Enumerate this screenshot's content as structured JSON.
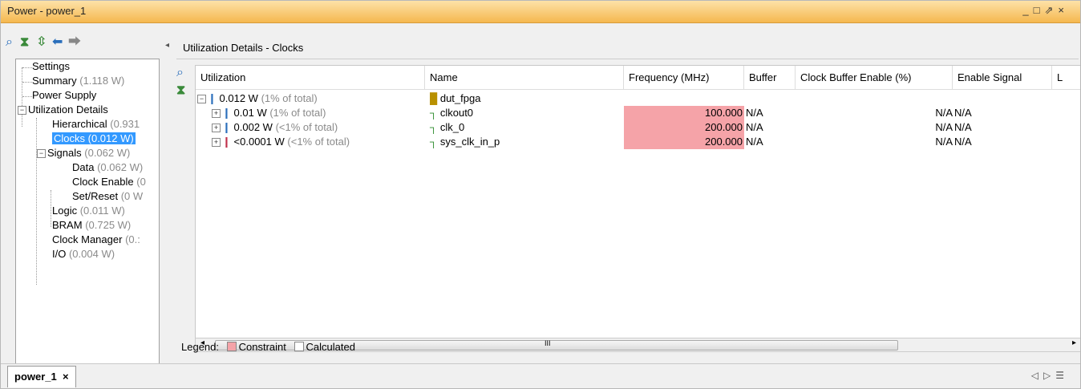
{
  "window": {
    "title": "Power - power_1"
  },
  "window_controls": {
    "minimize": "_",
    "restore": "□",
    "float": "⇗",
    "close": "×"
  },
  "left_toolbar": {
    "search_icon": "search-icon",
    "collapse_icon": "collapse-all-icon",
    "expand_icon": "expand-all-icon",
    "back_icon": "back-arrow-icon",
    "forward_icon": "forward-arrow-icon"
  },
  "tree": {
    "settings": "Settings",
    "summary": {
      "label": "Summary",
      "value": "(1.118 W)"
    },
    "power_supply": "Power Supply",
    "utilization_details": "Utilization Details",
    "hierarchical": {
      "label": "Hierarchical",
      "value": "(0.931"
    },
    "clocks": {
      "label": "Clocks",
      "value": "(0.012 W)"
    },
    "signals": {
      "label": "Signals",
      "value": "(0.062 W)"
    },
    "data": {
      "label": "Data",
      "value": "(0.062 W)"
    },
    "clock_enable": {
      "label": "Clock Enable",
      "value": "(0"
    },
    "set_reset": {
      "label": "Set/Reset",
      "value": "(0 W"
    },
    "logic": {
      "label": "Logic",
      "value": "(0.011 W)"
    },
    "bram": {
      "label": "BRAM",
      "value": "(0.725 W)"
    },
    "clock_manager": {
      "label": "Clock Manager",
      "value": "(0.:"
    },
    "io": {
      "label": "I/O",
      "value": "(0.004 W)"
    }
  },
  "panel": {
    "title": "Utilization Details - Clocks"
  },
  "table": {
    "headers": [
      "Utilization",
      "Name",
      "Frequency (MHz)",
      "Buffer",
      "Clock Buffer Enable (%)",
      "Enable Signal",
      "L"
    ],
    "root": {
      "util": "0.012 W",
      "util_note": "(1% of total)",
      "name": "dut_fpga"
    },
    "rows": [
      {
        "util": "0.01 W",
        "util_note": "(1% of total)",
        "name": "clkout0",
        "freq": "100.000",
        "buffer": "N/A",
        "cbe": "N/A",
        "enable": "N/A"
      },
      {
        "util": "0.002 W",
        "util_note": "(<1% of total)",
        "name": "clk_0",
        "freq": "200.000",
        "buffer": "N/A",
        "cbe": "N/A",
        "enable": "N/A"
      },
      {
        "util": "<0.0001 W",
        "util_note": "(<1% of total)",
        "name": "sys_clk_in_p",
        "freq": "200.000",
        "buffer": "N/A",
        "cbe": "N/A",
        "enable": "N/A"
      }
    ]
  },
  "scroll_thumb_glyph": "III",
  "legend": {
    "label": "Legend:",
    "constraint": "Constraint",
    "calculated": "Calculated"
  },
  "colors": {
    "constraint": "#f5a3a8",
    "titlebar": "#f8c96a",
    "selection": "#3399ff"
  },
  "bottom_tab": {
    "label": "power_1",
    "close": "×"
  },
  "bottom_nav": {
    "left": "◁",
    "right": "▷",
    "list": "☰"
  }
}
